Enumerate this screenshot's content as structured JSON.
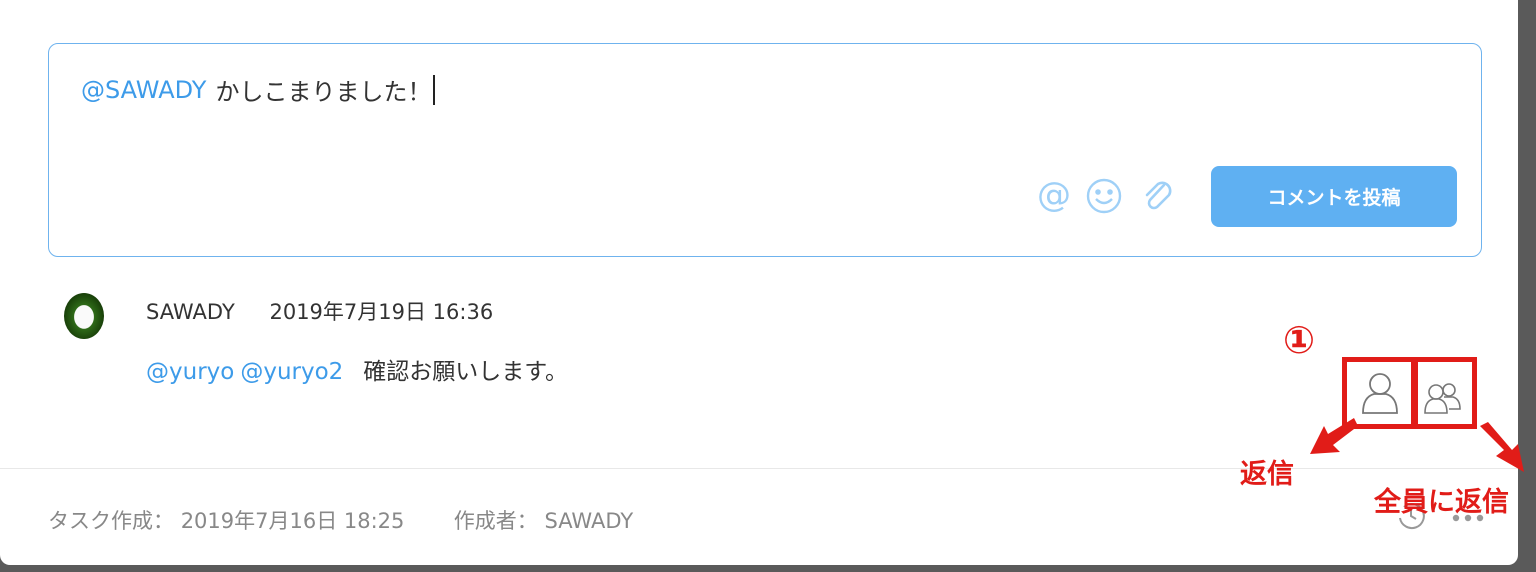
{
  "composer": {
    "mention": "@SAWADY",
    "text": "かしこまりました！",
    "post_button": "コメントを投稿",
    "tools": [
      "at-icon",
      "emoji-icon",
      "paperclip-icon"
    ]
  },
  "comment": {
    "author": "SAWADY",
    "datetime": "2019年7月19日 16:36",
    "mentions": [
      "@yuryo",
      "@yuryo2"
    ],
    "text": "確認お願いします。",
    "actions": [
      "reply-icon",
      "reply-all-icon"
    ]
  },
  "footer": {
    "created_label": "タスク作成：",
    "created_value": "2019年7月16日 18:25",
    "author_label": "作成者：",
    "author_value": "SAWADY"
  },
  "annotations": {
    "step": "①",
    "reply": "返信",
    "reply_all": "全員に返信",
    "color": "#e11c18"
  },
  "colors": {
    "accent": "#5fb0f2",
    "mention": "#3d9be9"
  }
}
